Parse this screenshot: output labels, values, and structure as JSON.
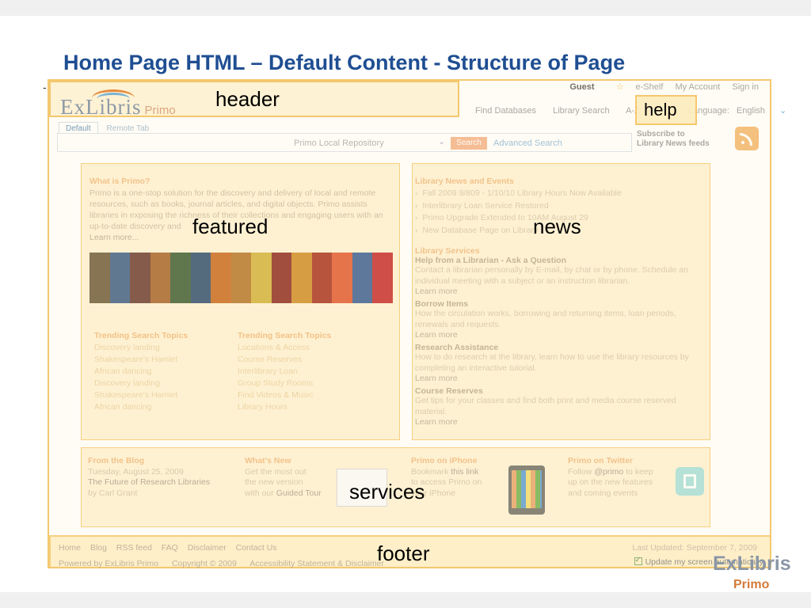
{
  "slide": {
    "title": "Home Page HTML – Default Content - Structure of Page"
  },
  "labels": {
    "header": "header",
    "help": "help",
    "featured": "featured",
    "news": "news",
    "services": "services",
    "footer": "footer"
  },
  "header": {
    "logo_ex": "ExLibris",
    "logo_primo": "Primo",
    "top_links": [
      "Guest",
      "e-Shelf",
      "My Account",
      "Sign in"
    ],
    "nav_links": [
      "Find Databases",
      "Library Search",
      "A-Z",
      "Language:",
      "English"
    ]
  },
  "search": {
    "tabs": [
      "Default",
      "Remote Tab"
    ],
    "scope": "Primo Local Repository",
    "button": "Search",
    "advanced": "Advanced Search"
  },
  "subscribe": {
    "line1": "Subscribe to",
    "line2": "Library News feeds"
  },
  "featured": {
    "title": "What is Primo?",
    "text": "Primo is a one-stop solution for the discovery and delivery of local and remote resources, such as books, journal articles, and digital objects. Primo assists libraries in exposing the richness of their collections and engaging users with an up-to-date discovery and",
    "learn_more": "Learn more...",
    "trending": [
      {
        "heading": "Trending Search Topics",
        "items": [
          "Discovery landing",
          "Shakespeare's Hamlet",
          "African dancing",
          "Discovery landing",
          "Shakespeare's Hamlet",
          "African dancing"
        ]
      },
      {
        "heading": "Trending Search Topics",
        "items": [
          "Locations & Access",
          "Course Reserves",
          "Interlibrary Loan",
          "Group Study Rooms",
          "Find Videos & Music",
          "Library Hours"
        ]
      }
    ]
  },
  "news": {
    "title": "Library News and Events",
    "items": [
      "Fall 2009 9/809 - 1/10/10 Library Hours Now Available",
      "Interlibrary Loan Service Restored",
      "Primo Upgrade Extended to 10AM August 29",
      "New Database Page on Library"
    ],
    "services_title": "Library Services",
    "sections": [
      {
        "heading": "Help from a Librarian - Ask a Question",
        "text": "Contact a librarian personally by E-mail, by chat or by phone. Schedule an individual meeting with a subject or an instruction librarian.",
        "more": "Learn more"
      },
      {
        "heading": "Borrow Items",
        "text": "How the circulation works, borrowing and returning items, loan periods, renewals and requests.",
        "more": "Learn more"
      },
      {
        "heading": "Research Assistance",
        "text": "How to do research at the library, learn how to use the library resources by completing an interactive tutorial.",
        "more": "Learn more"
      },
      {
        "heading": "Course Reserves",
        "text": "Get tips for your classes and find both print and media course reserved material.",
        "more": "Learn more"
      }
    ]
  },
  "services": {
    "blog": {
      "heading": "From the Blog",
      "date": "Tuesday, August 25, 2009",
      "link": "The Future of Research Libraries",
      "author": "by Carl Grant"
    },
    "whats_new": {
      "heading": "What's New",
      "l1": "Get the most out",
      "l2": "the new version",
      "l3": "with our",
      "link": "Guided Tour"
    },
    "iphone": {
      "heading": "Primo on iPhone",
      "l1": "Bookmark",
      "link": "this link",
      "l2": "to access Primo on",
      "l3": "your iPhone"
    },
    "twitter": {
      "heading": "Primo on Twitter",
      "l1": "Follow",
      "handle": "@primo",
      "l1b": "to keep",
      "l2": "up on the new features",
      "l3": "and coming events"
    }
  },
  "footer": {
    "links": [
      "Home",
      "Blog",
      "RSS feed",
      "FAQ",
      "Disclaimer",
      "Contact Us"
    ],
    "sub": [
      "Powered by ExLibris Primo",
      "Copyright © 2009",
      "Accessibility Statement & Disclaimer"
    ],
    "last_updated": "Last Updated: September 7, 2009",
    "auto_update": "Update my screen automatically"
  },
  "brand": {
    "ex": "ExLibris",
    "primo": "Primo"
  }
}
